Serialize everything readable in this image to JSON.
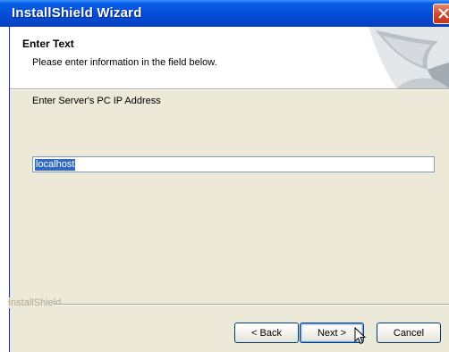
{
  "window": {
    "title": "InstallShield Wizard"
  },
  "header": {
    "title": "Enter Text",
    "subtitle": "Please enter information in the field below."
  },
  "form": {
    "prompt": "Enter Server's PC IP Address",
    "ip_value": "localhost"
  },
  "footer": {
    "brand": "InstallShield",
    "back_label": "< Back",
    "next_label": "Next >",
    "cancel_label": "Cancel"
  },
  "colors": {
    "title_bar": "#0550dc",
    "dialog_bg": "#ece9d8",
    "selection": "#316ac5",
    "close_button": "#d5472c"
  },
  "icons": [
    "close-icon",
    "installshield-banner-art",
    "mouse-pointer-icon"
  ]
}
